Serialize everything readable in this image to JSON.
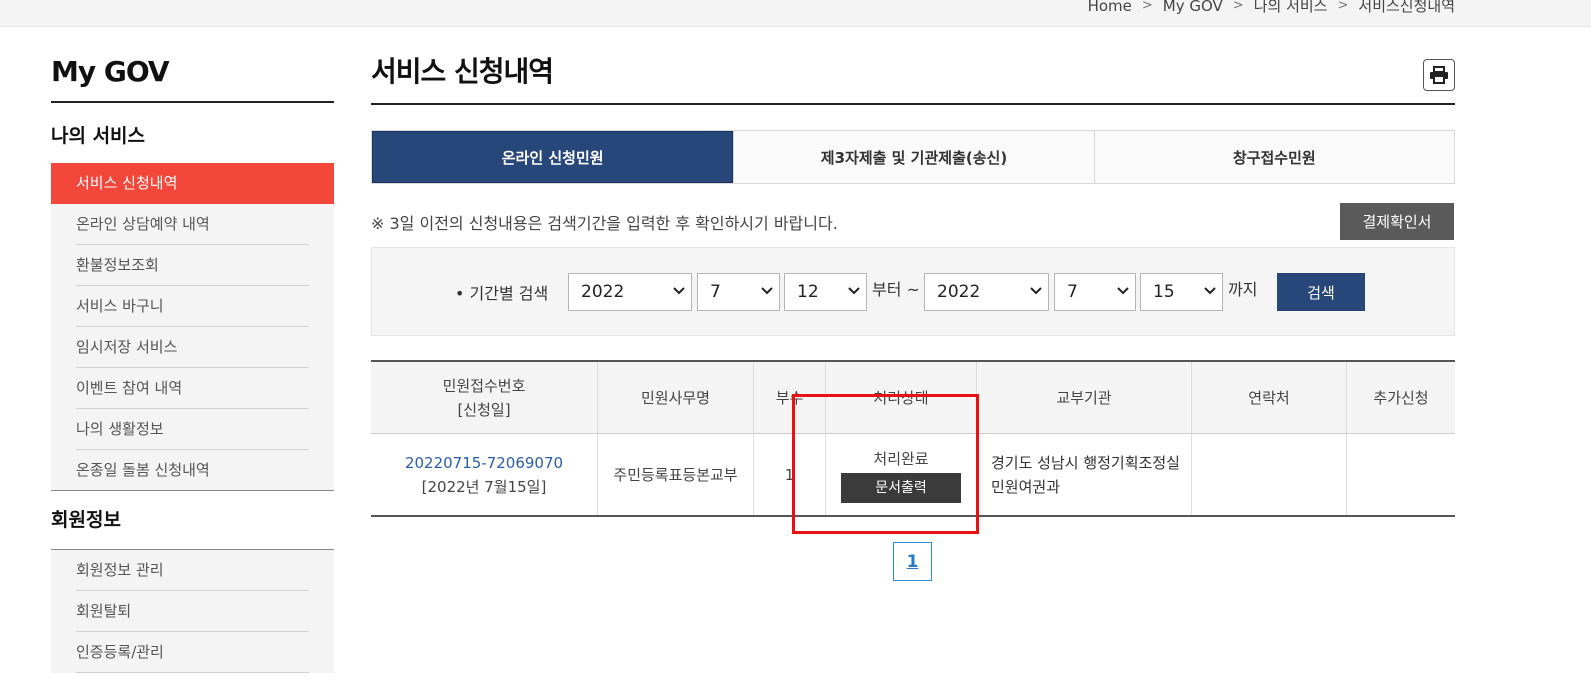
{
  "breadcrumb": [
    "Home",
    "My GOV",
    "나의 서비스",
    "서비스신청내역"
  ],
  "sidebar": {
    "title": "My GOV",
    "section1": "나의 서비스",
    "items1": [
      {
        "label": "서비스 신청내역",
        "active": true
      },
      {
        "label": "온라인 상담예약 내역"
      },
      {
        "label": "환불정보조회"
      },
      {
        "label": "서비스 바구니"
      },
      {
        "label": "임시저장 서비스"
      },
      {
        "label": "이벤트 참여 내역"
      },
      {
        "label": "나의 생활정보"
      },
      {
        "label": "온종일 돌봄 신청내역"
      }
    ],
    "section2": "회원정보",
    "items2": [
      {
        "label": "회원정보 관리"
      },
      {
        "label": "회원탈퇴"
      },
      {
        "label": "인증등록/관리"
      }
    ]
  },
  "main": {
    "title": "서비스 신청내역",
    "print_icon": "printer-icon",
    "tabs": [
      {
        "label": "온라인 신청민원",
        "active": true
      },
      {
        "label": "제3자제출 및 기관제출(송신)"
      },
      {
        "label": "창구접수민원"
      }
    ],
    "notice": "※ 3일 이전의 신청내용은 검색기간을 입력한 후 확인하시기 바랍니다.",
    "receipt_button": "결제확인서",
    "search": {
      "label": "• 기간별 검색",
      "from_year": "2022",
      "from_month": "7",
      "from_day": "12",
      "from_text": "부터 ~",
      "to_year": "2022",
      "to_month": "7",
      "to_day": "15",
      "to_text": "까지",
      "button": "검색"
    },
    "table": {
      "headers": [
        "민원접수번호",
        "[신청일]",
        "민원사무명",
        "부수",
        "처리상태",
        "교부기관",
        "연락처",
        "추가신청"
      ],
      "rows": [
        {
          "receipt_no": "20220715-72069070",
          "date": "[2022년 7월15일]",
          "service": "주민등록표등본교부",
          "copies": "1",
          "status": "처리완료",
          "doc_button": "문서출력",
          "agency_line1": "경기도 성남시 행정기획조정실",
          "agency_line2": "민원여권과",
          "contact": "",
          "extra": ""
        }
      ]
    },
    "pagination": {
      "current": "1"
    }
  },
  "colors": {
    "active_menu": "#f2473a",
    "navy": "#27477a",
    "highlight": "#e81212"
  }
}
